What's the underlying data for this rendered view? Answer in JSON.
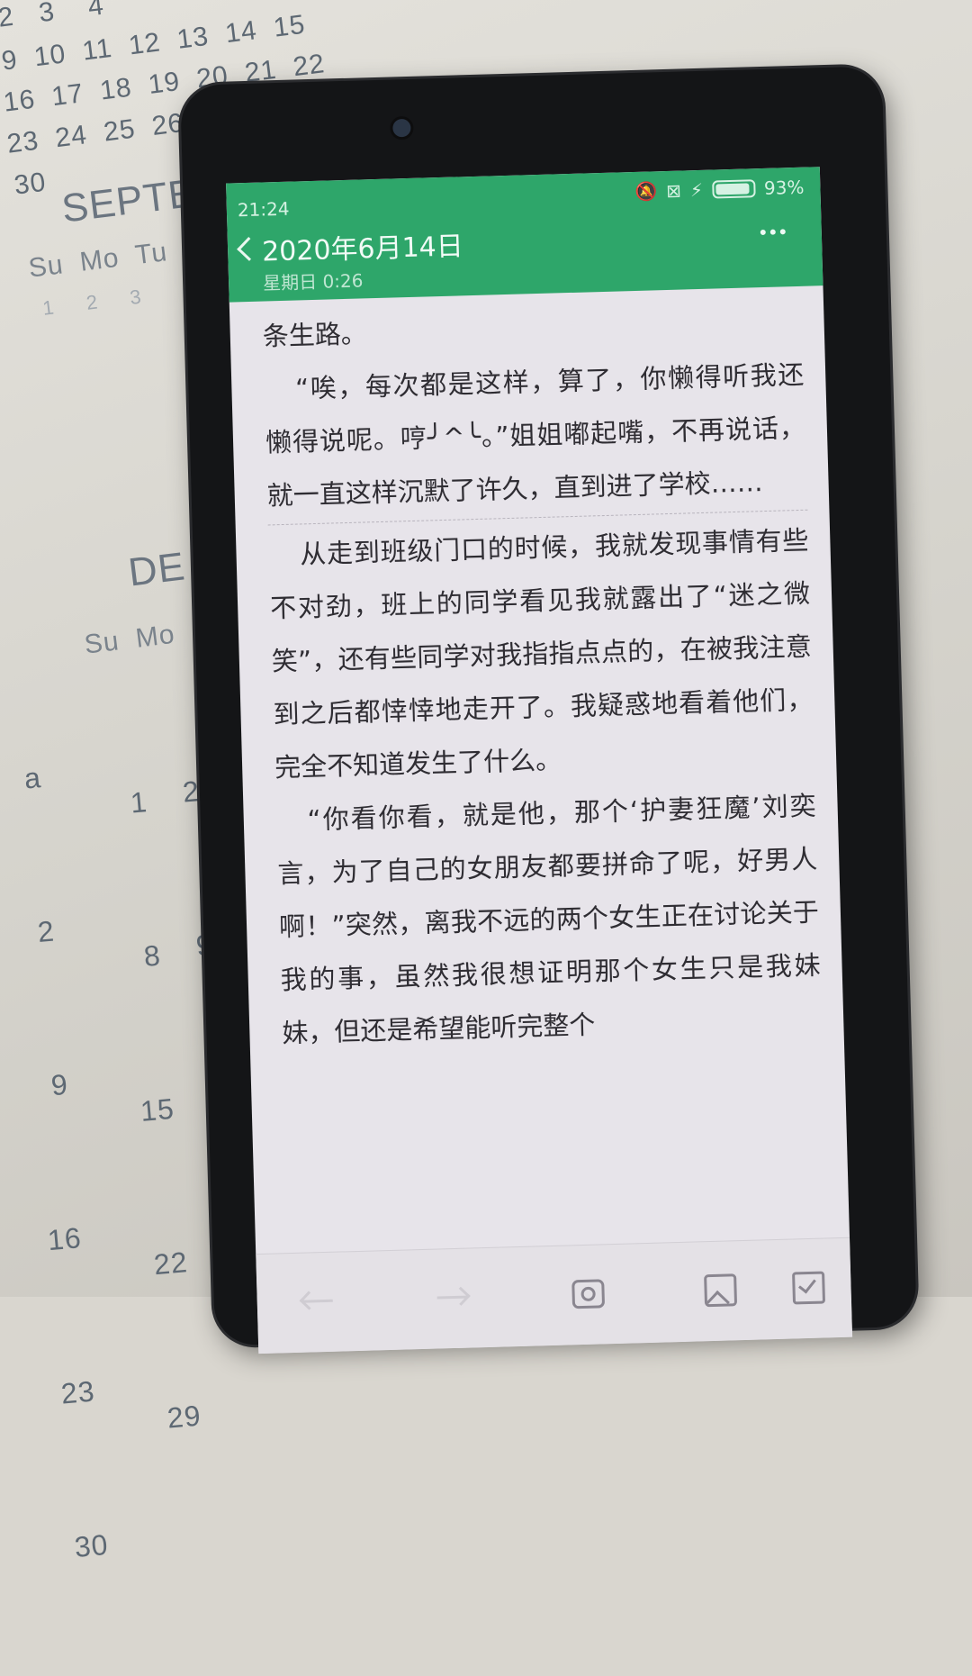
{
  "calendar": {
    "rows_top": [
      "2   3    4",
      "9  10  11  12  13  14  15",
      "16  17  18  19  20  21  22",
      "23  24  25  26  27  28  29",
      "30"
    ],
    "month_1": "SEPTE",
    "weekdays_1": "Su  Mo  Tu  W",
    "dates_1": "1     2     3",
    "month_2": "DE",
    "weekdays_2": "Su  Mo",
    "col_left": [
      "a",
      "2",
      "9",
      "16",
      "23",
      "30"
    ],
    "col_mid": [
      "1",
      "8",
      "15",
      "22",
      "29"
    ],
    "col_right": [
      "2",
      "9"
    ]
  },
  "status": {
    "time": "21:24",
    "battery": "93%",
    "battery_level": 0.93
  },
  "header": {
    "title": "2020年6月14日",
    "subtitle": "星期日 0:26"
  },
  "content": {
    "paragraphs": [
      "条生路。",
      "“唉，每次都是这样，算了，你懒得听我还懒得说呢。哼╯^╰。”姐姐嘟起嘴，不再说话，就一直这样沉默了许久，直到进了学校……",
      "从走到班级门口的时候，我就发现事情有些不对劲，班上的同学看见我就露出了“迷之微笑”，还有些同学对我指指点点的，在被我注意到之后都悻悻地走开了。我疑惑地看着他们，完全不知道发生了什么。",
      "“你看你看，就是他，那个‘护妻狂魔’刘奕言，为了自己的女朋友都要拼命了呢，好男人啊！”突然，离我不远的两个女生正在讨论关于我的事，虽然我很想证明那个女生只是我妹妹，但还是希望能听完整个"
    ]
  },
  "toolbar": {
    "undo": "undo-icon",
    "redo": "redo-icon",
    "camera": "camera-icon",
    "image": "image-icon",
    "checkbox": "checkbox-icon"
  }
}
